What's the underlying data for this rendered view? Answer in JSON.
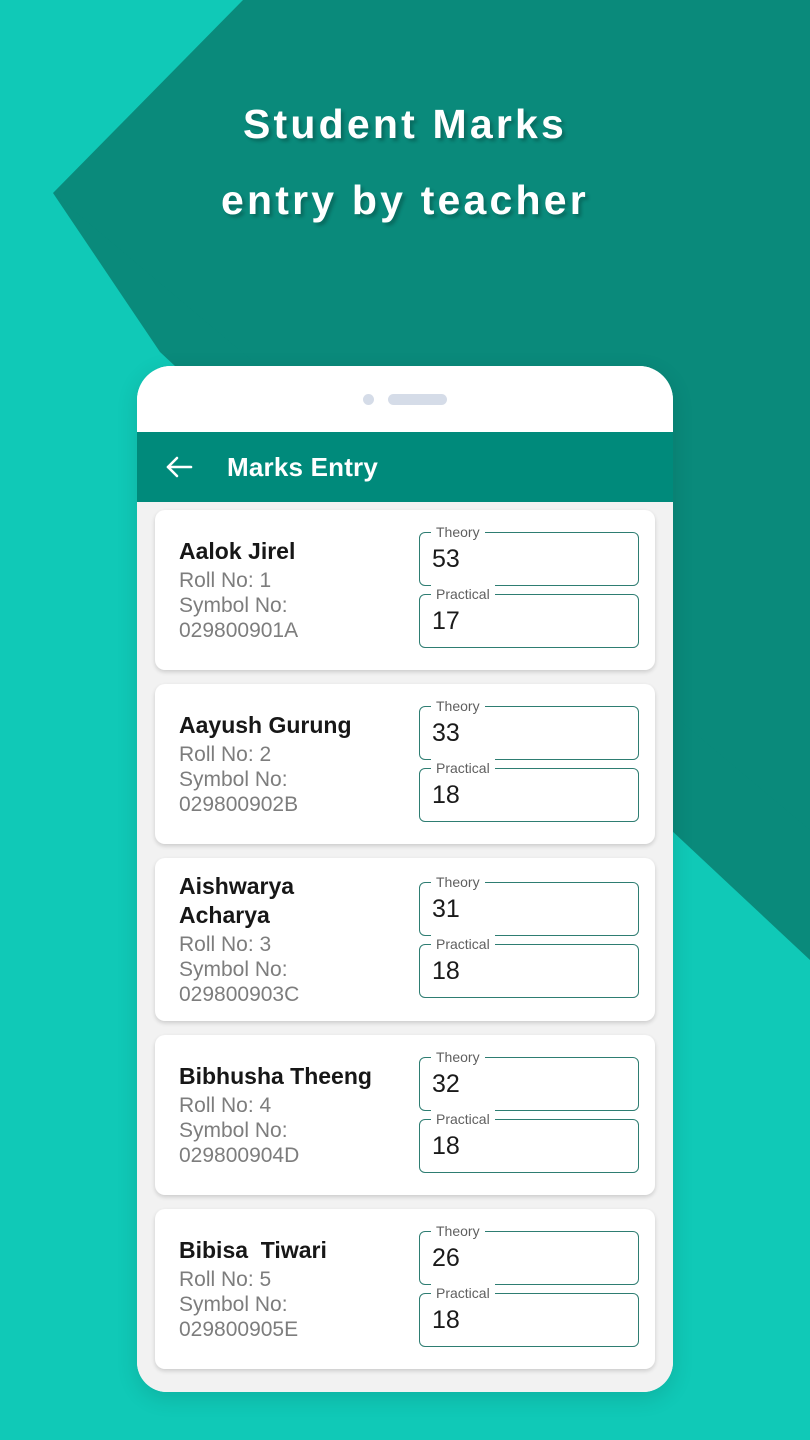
{
  "promo": {
    "line1": "Student Marks",
    "line2": "entry by teacher"
  },
  "colors": {
    "background_light": "#10C9B7",
    "background_dark": "#0A8A7B",
    "appbar": "#008A7B",
    "field_border": "#2E7D72",
    "card_background": "#FFFFFF",
    "body_background": "#F2F2F2"
  },
  "appbar": {
    "back_icon": "arrow-left-icon",
    "title": "Marks Entry"
  },
  "phone_status": {
    "camera_icon": "camera-dot",
    "speaker_icon": "speaker-pill"
  },
  "fields": {
    "theory_label": "Theory",
    "practical_label": "Practical"
  },
  "students": [
    {
      "name": "Aalok Jirel",
      "roll": "Roll No: 1",
      "symbol_label": "Symbol No:",
      "symbol": "029800901A",
      "theory": "53",
      "practical": "17"
    },
    {
      "name": "Aayush Gurung",
      "roll": "Roll No: 2",
      "symbol_label": "Symbol No:",
      "symbol": "029800902B",
      "theory": "33",
      "practical": "18"
    },
    {
      "name": "Aishwarya\nAcharya",
      "roll": "Roll No: 3",
      "symbol_label": "Symbol No:",
      "symbol": "029800903C",
      "theory": "31",
      "practical": "18"
    },
    {
      "name": "Bibhusha Theeng",
      "roll": "Roll No: 4",
      "symbol_label": "Symbol No:",
      "symbol": "029800904D",
      "theory": "32",
      "practical": "18"
    },
    {
      "name": "Bibisa  Tiwari",
      "roll": "Roll No: 5",
      "symbol_label": "Symbol No:",
      "symbol": "029800905E",
      "theory": "26",
      "practical": "18"
    }
  ]
}
